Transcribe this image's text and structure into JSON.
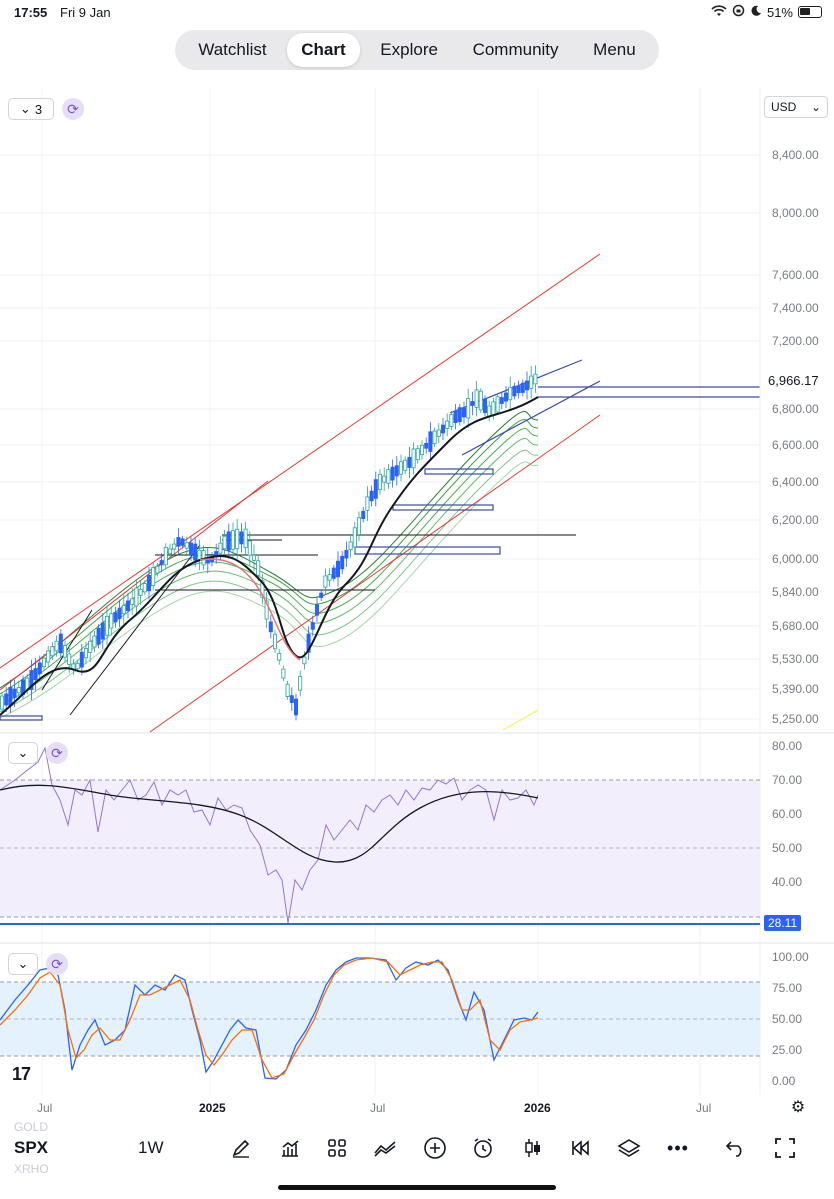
{
  "status": {
    "time": "17:55",
    "date": "Fri 9 Jan",
    "battery": "51%",
    "battery_level": 0.51
  },
  "nav": {
    "tabs": [
      {
        "label": "Watchlist",
        "active": false
      },
      {
        "label": "Chart",
        "active": true
      },
      {
        "label": "Explore",
        "active": false
      },
      {
        "label": "Community",
        "active": false
      },
      {
        "label": "Menu",
        "active": false
      }
    ]
  },
  "main_pane": {
    "collapse_label": "3",
    "currency": "USD",
    "last_price": "6,966.17",
    "price_ticks": [
      "8,400.00",
      "8,000.00",
      "7,600.00",
      "7,400.00",
      "7,200.00",
      "6,800.00",
      "6,600.00",
      "6,400.00",
      "6,200.00",
      "6,000.00",
      "5,840.00",
      "5,680.00",
      "5,530.00",
      "5,390.00",
      "5,250.00"
    ]
  },
  "rsi_pane": {
    "ticks": [
      "80.00",
      "70.00",
      "60.00",
      "50.00",
      "40.00"
    ],
    "last_value": "28.11"
  },
  "stoch_pane": {
    "ticks": [
      "100.00",
      "75.00",
      "50.00",
      "25.00",
      "0.00"
    ]
  },
  "time_axis": {
    "labels": [
      "Jul",
      "2025",
      "Jul",
      "2026",
      "Jul"
    ]
  },
  "bottom": {
    "symbol": "SPX",
    "interval": "1W",
    "ghost_top": "GOLD",
    "ghost_bottom": "XRHO",
    "tools": [
      "draw-icon",
      "indicators-icon",
      "layouts-icon",
      "compare-icon",
      "add-icon",
      "alert-icon",
      "bar-style-icon",
      "replay-icon",
      "layers-icon",
      "more-icon",
      "undo-icon",
      "fullscreen-icon"
    ]
  },
  "logo": "17",
  "colors": {
    "accent_blue": "#2962ff",
    "candle_up": "#26a69a",
    "candle_down": "#2962ff",
    "channel_red": "#e53935",
    "rsi_line": "#9575cd",
    "rsi_band": "#f3eefc",
    "stoch_k": "#2962ff",
    "stoch_d": "#ff6d00",
    "stoch_band": "#e3f2fd"
  }
}
